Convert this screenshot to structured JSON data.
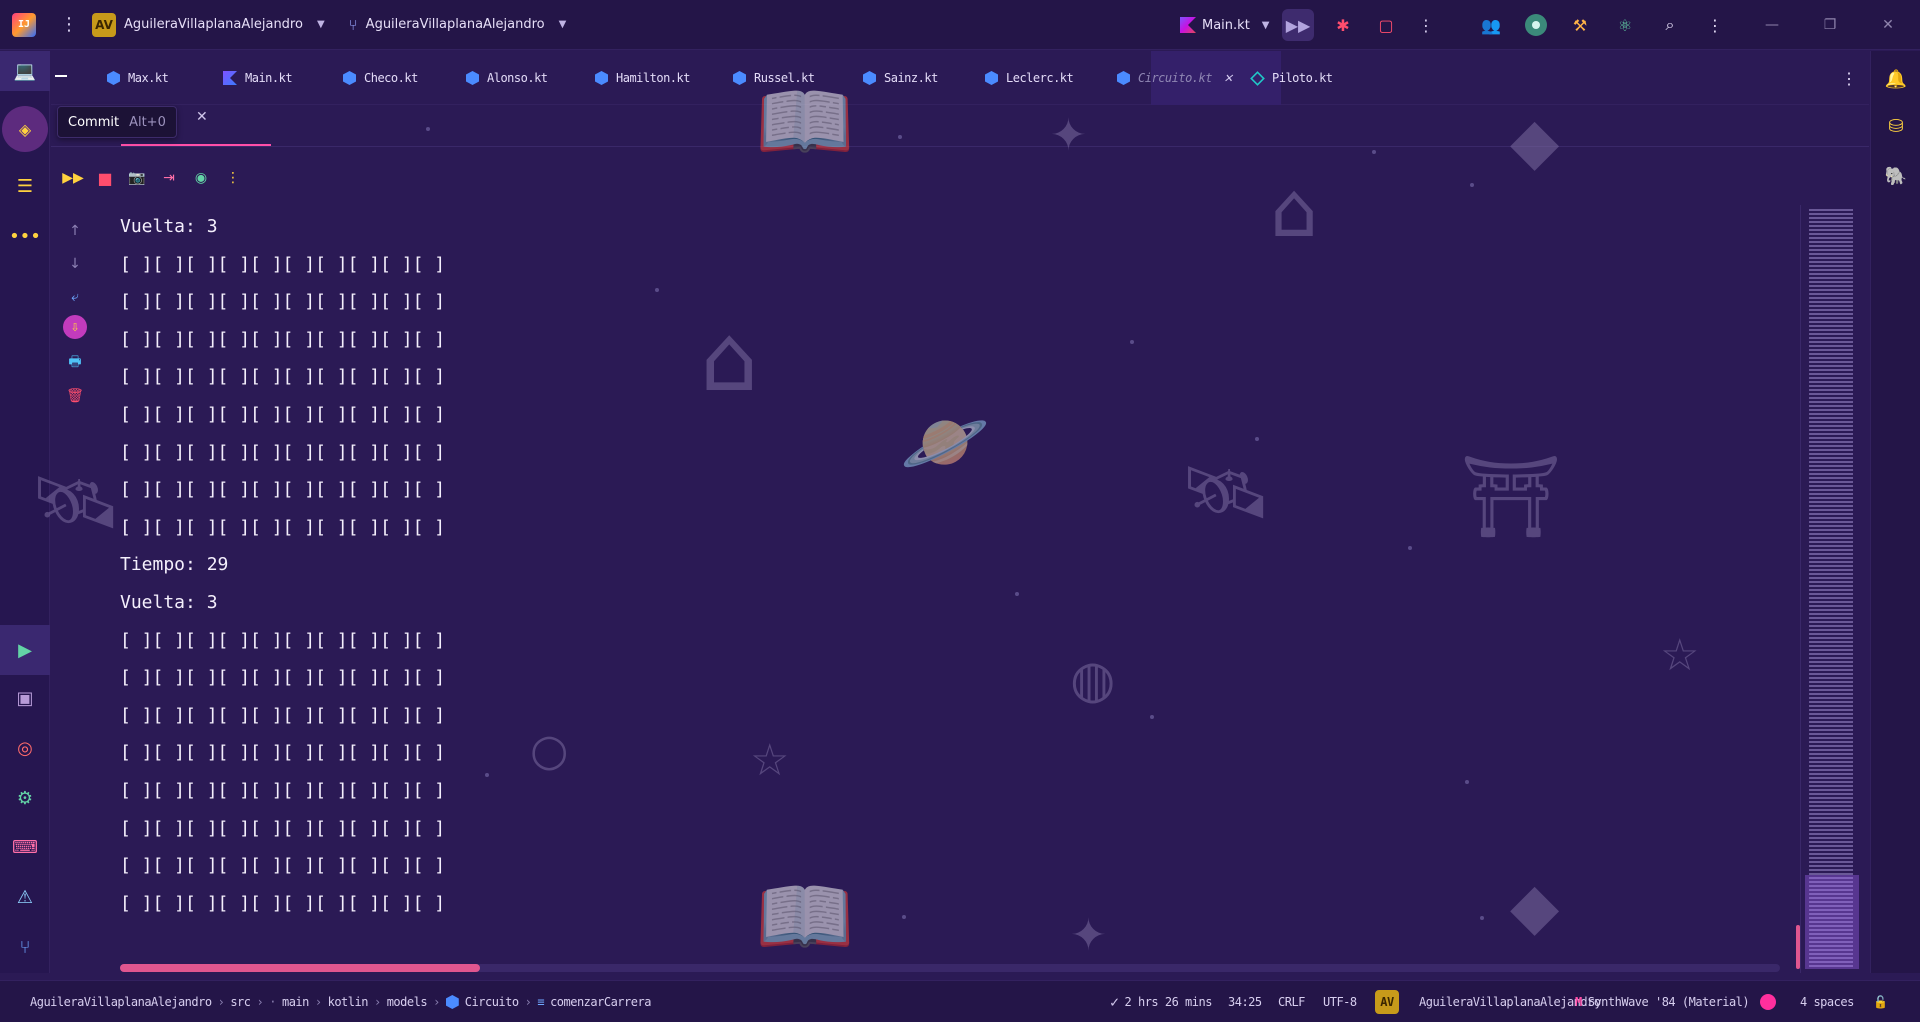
{
  "titlebar": {
    "project_initials": "AV",
    "project_name": "AguileraVillaplanaAlejandro",
    "branch_name": "AguileraVillaplanaAlejandro",
    "run_config": "Main.kt"
  },
  "tabs": [
    {
      "label": "Max.kt",
      "icon": "cube-icon"
    },
    {
      "label": "Main.kt",
      "icon": "kotlin-icon"
    },
    {
      "label": "Checo.kt",
      "icon": "cube-icon"
    },
    {
      "label": "Alonso.kt",
      "icon": "cube-icon"
    },
    {
      "label": "Hamilton.kt",
      "icon": "cube-icon"
    },
    {
      "label": "Russel.kt",
      "icon": "cube-icon"
    },
    {
      "label": "Sainz.kt",
      "icon": "cube-icon"
    },
    {
      "label": "Leclerc.kt",
      "icon": "cube-icon"
    },
    {
      "label": "Circuito.kt",
      "icon": "cube-icon",
      "selected": true
    },
    {
      "label": "Piloto.kt",
      "icon": "interface-icon"
    }
  ],
  "tooltip": {
    "label": "Commit",
    "shortcut": "Alt+0"
  },
  "console": {
    "lines": [
      "Vuelta: 3",
      "[ ][ ][ ][ ][ ][ ][ ][ ][ ][ ]",
      "[ ][ ][ ][ ][ ][ ][ ][ ][ ][ ]",
      "[ ][ ][ ][ ][ ][ ][ ][ ][ ][ ]",
      "[ ][ ][ ][ ][ ][ ][ ][ ][ ][ ]",
      "[ ][ ][ ][ ][ ][ ][ ][ ][ ][ ]",
      "[ ][ ][ ][ ][ ][ ][ ][ ][ ][ ]",
      "[ ][ ][ ][ ][ ][ ][ ][ ][ ][ ]",
      "[ ][ ][ ][ ][ ][ ][ ][ ][ ][ ]",
      "Tiempo: 29",
      "Vuelta: 3",
      "[ ][ ][ ][ ][ ][ ][ ][ ][ ][ ]",
      "[ ][ ][ ][ ][ ][ ][ ][ ][ ][ ]",
      "[ ][ ][ ][ ][ ][ ][ ][ ][ ][ ]",
      "[ ][ ][ ][ ][ ][ ][ ][ ][ ][ ]",
      "[ ][ ][ ][ ][ ][ ][ ][ ][ ][ ]",
      "[ ][ ][ ][ ][ ][ ][ ][ ][ ][ ]",
      "[ ][ ][ ][ ][ ][ ][ ][ ][ ][ ]",
      "[ ][ ][ ][ ][ ][ ][ ][ ][ ][ ]"
    ]
  },
  "statusbar": {
    "breadcrumbs": [
      "AguileraVillaplanaAlejandro",
      "src",
      "main",
      "kotlin",
      "models",
      "Circuito",
      "comenzarCarrera"
    ],
    "time_tracked": "2 hrs 26 mins",
    "cursor_position": "34:25",
    "line_separator": "CRLF",
    "encoding": "UTF-8",
    "user_initials": "AV",
    "user_name": "AguileraVillaplanaAlejandro",
    "theme": "SynthWave '84 (Material)",
    "indent": "4 spaces"
  },
  "colors": {
    "background": "#2b1a55",
    "accent_pink": "#ff4fa8",
    "accent_yellow": "#ffd23f",
    "stop_red": "#ff4d6d"
  }
}
